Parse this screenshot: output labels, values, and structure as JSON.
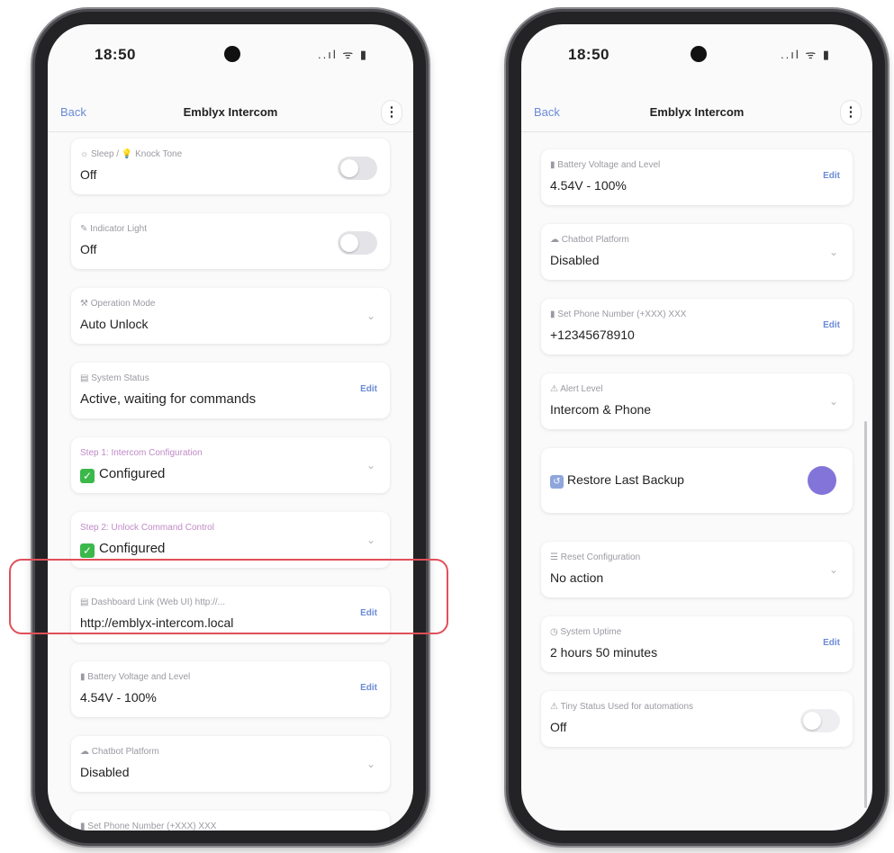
{
  "left_phone": {
    "time": "18:50",
    "status_icons": "..ıl ᯤ ▮",
    "back": "Back",
    "title": "Emblyx Intercom",
    "menu_icon": "⋮",
    "cards": [
      {
        "label": "☼ Sleep / 💡 Knock Tone",
        "value": "Off",
        "control": "toggle"
      },
      {
        "label": "✎ Indicator Light",
        "value": "Off",
        "control": "toggle"
      },
      {
        "label": "⚒ Operation Mode",
        "value": "Auto Unlock",
        "control": "chevron"
      },
      {
        "label": "▤ System Status",
        "value": "Active, waiting for commands",
        "control": "edit"
      },
      {
        "label": "Step 1: Intercom Configuration",
        "value": "Configured",
        "control": "chevron",
        "check": true
      },
      {
        "label": "Step 2: Unlock Command Control",
        "value": "Configured",
        "control": "chevron",
        "check": true
      },
      {
        "label": "▤ Dashboard Link (Web UI) http://...",
        "value": "http://emblyx-intercom.local",
        "control": "edit"
      },
      {
        "label": "▮ Battery Voltage and Level",
        "value": "4.54V - 100%",
        "control": "edit"
      },
      {
        "label": "☁ Chatbot Platform",
        "value": "Disabled",
        "control": "chevron"
      },
      {
        "label": "▮ Set Phone Number (+XXX) XXX",
        "value": "",
        "control": "none"
      }
    ],
    "edit_label": "Edit"
  },
  "right_phone": {
    "time": "18:50",
    "status_icons": "..ıl ᯤ ▮",
    "back": "Back",
    "title": "Emblyx Intercom",
    "menu_icon": "⋮",
    "cards": [
      {
        "label": "▮ Battery Voltage and Level",
        "value": "4.54V - 100%",
        "control": "edit"
      },
      {
        "label": "☁ Chatbot Platform",
        "value": "Disabled",
        "control": "chevron"
      },
      {
        "label": "▮ Set Phone Number (+XXX) XXX",
        "value": "+12345678910",
        "control": "edit"
      },
      {
        "label": "⚠ Alert Level",
        "value": "Intercom & Phone",
        "control": "chevron"
      },
      {
        "label": "",
        "value": "Restore Last Backup",
        "control": "circle"
      },
      {
        "label": "☰ Reset Configuration",
        "value": "No action",
        "control": "chevron"
      },
      {
        "label": "◷ System Uptime",
        "value": "2 hours 50 minutes",
        "control": "edit"
      },
      {
        "label": "⚠ Tiny Status Used for automations",
        "value": "Off",
        "control": "toggle"
      }
    ],
    "edit_label": "Edit"
  },
  "colors": {
    "accent": "#6b8ad6",
    "highlight": "#e0505a",
    "check": "#3bb84a",
    "circle_button": "#8374d9"
  }
}
